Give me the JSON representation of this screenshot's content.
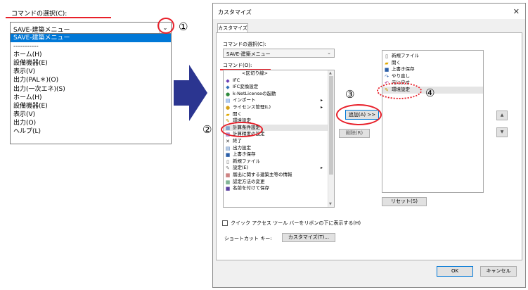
{
  "left_panel": {
    "title": "コマンドの選択(C):",
    "combo_value": "SAVE-建築メニュー",
    "list_items": [
      {
        "label": "SAVE-建築メニュー",
        "selected": true
      },
      {
        "label": "-----------",
        "selected": false
      },
      {
        "label": "ホーム(H)",
        "selected": false
      },
      {
        "label": "設備機器(E)",
        "selected": false
      },
      {
        "label": "表示(V)",
        "selected": false
      },
      {
        "label": "出力(PAL＊)(O)",
        "selected": false
      },
      {
        "label": "出力(一次エネ)(S)",
        "selected": false
      },
      {
        "label": "ホーム(H)",
        "selected": false
      },
      {
        "label": "設備機器(E)",
        "selected": false
      },
      {
        "label": "表示(V)",
        "selected": false
      },
      {
        "label": "出力(O)",
        "selected": false
      },
      {
        "label": "ヘルプ(L)",
        "selected": false
      }
    ]
  },
  "annotations": {
    "n1": "①",
    "n2": "②",
    "n3": "③",
    "n4": "④"
  },
  "dialog": {
    "title": "カスタマイズ",
    "close": "✕",
    "tab": "カスタマイズ",
    "command_select_label": "コマンドの選択(C):",
    "command_select_value": "SAVE-建築メニュー",
    "commands_label": "コマンド(O):",
    "commands": [
      {
        "label": "<区切り線>",
        "icon": "",
        "sub": ""
      },
      {
        "label": "IFC",
        "icon": "ifc-icon",
        "sub": ""
      },
      {
        "label": "IFC変換設定",
        "icon": "ifc-settings-icon",
        "sub": ""
      },
      {
        "label": "k-NetLicenseの起動",
        "icon": "license-launch-icon",
        "sub": ""
      },
      {
        "label": "インポート",
        "icon": "import-icon",
        "sub": "▸"
      },
      {
        "label": "ライセンス管理(L)",
        "icon": "license-icon",
        "sub": "▸"
      },
      {
        "label": "開く",
        "icon": "open-folder-icon",
        "sub": ""
      },
      {
        "label": "環境設定",
        "icon": "settings-icon",
        "sub": ""
      },
      {
        "label": "計算条件設定",
        "icon": "calc-condition-icon",
        "sub": ""
      },
      {
        "label": "計算精度の設定",
        "icon": "calc-precision-icon",
        "sub": ""
      },
      {
        "label": "終了",
        "icon": "exit-icon",
        "sub": ""
      },
      {
        "label": "出力設定",
        "icon": "output-settings-icon",
        "sub": ""
      },
      {
        "label": "上書き保存",
        "icon": "save-icon",
        "sub": ""
      },
      {
        "label": "新規ファイル",
        "icon": "new-file-icon",
        "sub": ""
      },
      {
        "label": "設定(E)",
        "icon": "settings-menu-icon",
        "sub": "▸"
      },
      {
        "label": "届出に関する建築主等の情報",
        "icon": "owner-info-icon",
        "sub": ""
      },
      {
        "label": "認定方法の変更",
        "icon": "method-change-icon",
        "sub": ""
      },
      {
        "label": "名前を付けて保存",
        "icon": "save-as-icon",
        "sub": ""
      }
    ],
    "add_button": "追加(A) >>",
    "remove_button": "削除(R)",
    "quick_access": [
      {
        "label": "新規ファイル",
        "icon": "new-file-icon"
      },
      {
        "label": "開く",
        "icon": "open-folder-icon"
      },
      {
        "label": "上書き保存",
        "icon": "save-icon"
      },
      {
        "label": "やり直し",
        "icon": "redo-icon"
      },
      {
        "label": "元に戻す",
        "icon": "undo-icon"
      },
      {
        "label": "環境設定",
        "icon": "settings-icon"
      }
    ],
    "up_arrow": "▲",
    "down_arrow": "▼",
    "reset_button": "リセット(S)",
    "checkbox_label": "クイック アクセス ツール バーをリボンの下に表示する(H)",
    "shortcut_label": "ショートカット キー:",
    "customize_button": "カスタマイズ(T)...",
    "ok_button": "OK",
    "cancel_button": "キャンセル"
  },
  "colors": {
    "highlight": "#e8202a",
    "selection": "#0078d7",
    "arrow": "#2b3590"
  }
}
